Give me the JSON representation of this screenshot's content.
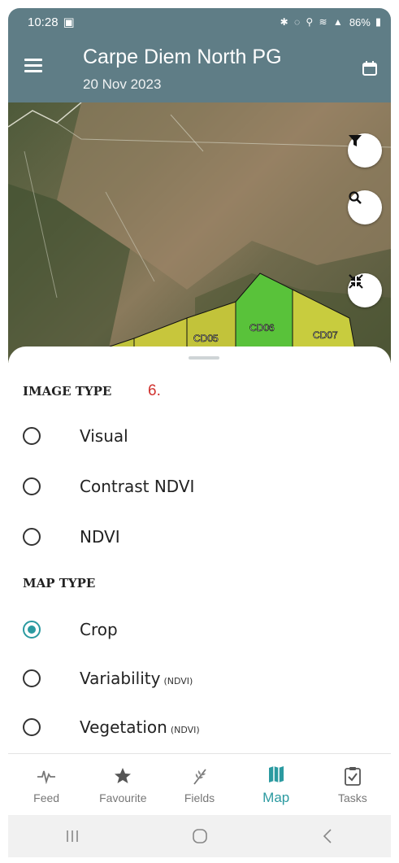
{
  "status_bar": {
    "time": "10:28",
    "battery": "86%"
  },
  "header": {
    "title": "Carpe Diem North PG",
    "date": "20 Nov 2023"
  },
  "map": {
    "field_labels": [
      "CD05",
      "CD06",
      "CD07"
    ]
  },
  "image_type": {
    "title": "IMAGE TYPE",
    "note": "6.",
    "options": [
      {
        "label": "Visual",
        "suffix": "",
        "selected": false
      },
      {
        "label": "Contrast NDVI",
        "suffix": "",
        "selected": false
      },
      {
        "label": "NDVI",
        "suffix": "",
        "selected": false
      }
    ]
  },
  "map_type": {
    "title": "MAP TYPE",
    "options": [
      {
        "label": "Crop",
        "suffix": "",
        "selected": true
      },
      {
        "label": "Variability",
        "suffix": "(NDVI)",
        "selected": false
      },
      {
        "label": "Vegetation",
        "suffix": "(NDVI)",
        "selected": false
      }
    ]
  },
  "tabs": [
    {
      "label": "Feed",
      "icon": "pulse-icon",
      "active": false
    },
    {
      "label": "Favourite",
      "icon": "star-icon",
      "active": false
    },
    {
      "label": "Fields",
      "icon": "wheat-icon",
      "active": false
    },
    {
      "label": "Map",
      "icon": "map-icon",
      "active": true
    },
    {
      "label": "Tasks",
      "icon": "clipboard-check-icon",
      "active": false
    }
  ],
  "colors": {
    "accent": "#2b9aa0",
    "header": "#5f7d86",
    "note": "#d0312d"
  }
}
